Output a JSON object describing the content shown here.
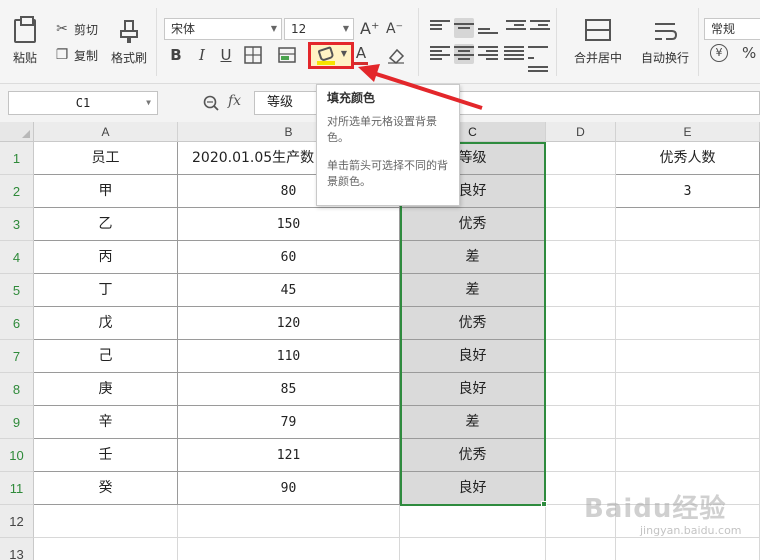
{
  "ribbon": {
    "paste_label": "粘贴",
    "cut_label": "剪切",
    "copy_label": "复制",
    "format_painter_label": "格式刷",
    "font_name": "宋体",
    "font_size": "12",
    "grow_font": "A⁺",
    "shrink_font": "A⁻",
    "bold": "B",
    "italic": "I",
    "underline": "U",
    "font_color": "A",
    "merge_center_label": "合并居中",
    "wrap_text_label": "自动换行",
    "number_format": "常规",
    "currency_symbol": "¥",
    "percent_symbol": "%"
  },
  "formula_bar": {
    "name_box": "C1",
    "fx": "fx",
    "value": "等级"
  },
  "tooltip": {
    "title": "填充颜色",
    "line1": "对所选单元格设置背景色。",
    "line2": "单击箭头可选择不同的背景颜色。"
  },
  "columns": [
    "A",
    "B",
    "C",
    "D",
    "E"
  ],
  "rows": [
    "1",
    "2",
    "3",
    "4",
    "5",
    "6",
    "7",
    "8",
    "9",
    "10",
    "11",
    "12",
    "13"
  ],
  "table": [
    [
      "员工",
      "2020.01.05生产数",
      "等级",
      "",
      "优秀人数"
    ],
    [
      "甲",
      "80",
      "良好",
      "",
      "3"
    ],
    [
      "乙",
      "150",
      "优秀",
      "",
      ""
    ],
    [
      "丙",
      "60",
      "差",
      "",
      ""
    ],
    [
      "丁",
      "45",
      "差",
      "",
      ""
    ],
    [
      "戊",
      "120",
      "优秀",
      "",
      ""
    ],
    [
      "己",
      "110",
      "良好",
      "",
      ""
    ],
    [
      "庚",
      "85",
      "良好",
      "",
      ""
    ],
    [
      "辛",
      "79",
      "差",
      "",
      ""
    ],
    [
      "壬",
      "121",
      "优秀",
      "",
      ""
    ],
    [
      "癸",
      "90",
      "良好",
      "",
      ""
    ],
    [
      "",
      "",
      "",
      "",
      ""
    ],
    [
      "",
      "",
      "",
      "",
      ""
    ]
  ],
  "watermark": "Baidu经验",
  "watermark_sub": "jingyan.baidu.com",
  "colors": {
    "selection": "#2e8b3e",
    "highlight_box": "#e3272b",
    "selected_fill": "#dadada"
  }
}
